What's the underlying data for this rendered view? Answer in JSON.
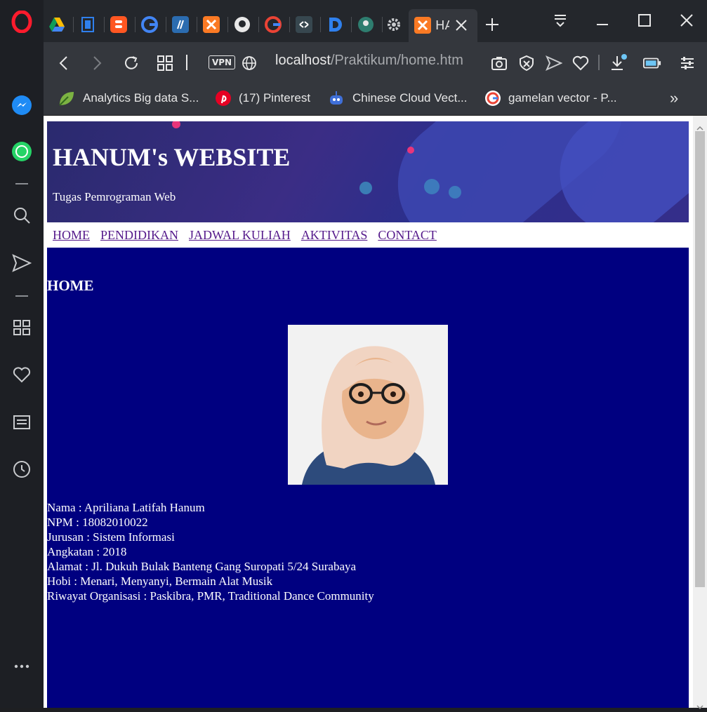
{
  "browser": {
    "active_tab_title": "HA",
    "url_host": "localhost",
    "url_path": "/Praktikum/home.htm",
    "vpn_label": "VPN",
    "bookmarks": [
      {
        "label": "Analytics Big data S...",
        "icon": "leaf-icon"
      },
      {
        "label": "(17) Pinterest",
        "icon": "pinterest-icon"
      },
      {
        "label": "Chinese Cloud Vect...",
        "icon": "robot-icon"
      },
      {
        "label": "gamelan vector - P...",
        "icon": "google-icon"
      }
    ],
    "more_label": "»"
  },
  "site": {
    "title": "HANUM's WEBSITE",
    "subtitle": "Tugas Pemrograman Web",
    "nav": [
      "HOME",
      "PENDIDIKAN",
      "JADWAL KULIAH",
      "AKTIVITAS",
      "CONTACT"
    ],
    "section_title": "HOME",
    "profile": [
      "Nama : Apriliana Latifah Hanum",
      "NPM : 18082010022",
      "Jurusan : Sistem Informasi",
      "Angkatan : 2018",
      "Alamat : Jl. Dukuh Bulak Banteng Gang Suropati 5/24 Surabaya",
      "Hobi : Menari, Menyanyi, Bermain Alat Musik",
      "Riwayat Organisasi : Paskibra, PMR, Traditional Dance Community"
    ]
  },
  "colors": {
    "main_bg": "#000080",
    "link": "#551a8b"
  }
}
